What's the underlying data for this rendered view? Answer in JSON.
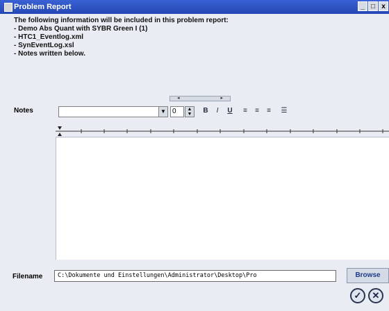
{
  "window": {
    "title": "Problem Report",
    "controls": [
      "_",
      "□",
      "x"
    ]
  },
  "info": {
    "heading": "The following information will be included in this problem report:",
    "items": [
      "- Demo Abs Quant with SYBR Green I (1)",
      "- HTC1_Eventlog.xml",
      "- SynEventLog.xsl",
      "- Notes written below."
    ]
  },
  "notes": {
    "label": "Notes",
    "font_value": "",
    "size_value": "0",
    "toolbar": {
      "bold": "B",
      "italic": "I",
      "underline": "U",
      "align_left": "≡",
      "align_center": "≡",
      "align_right": "≡",
      "bullets": "☰"
    },
    "text": ""
  },
  "file": {
    "label": "Filename",
    "value": "C:\\Dokumente und Einstellungen\\Administrator\\Desktop\\Pro",
    "browse_label": "Browse"
  },
  "actions": {
    "ok_symbol": "✓",
    "cancel_symbol": "✕"
  }
}
